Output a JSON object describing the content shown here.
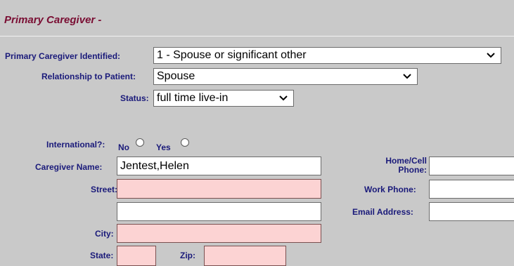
{
  "section": {
    "title": "Primary Caregiver -"
  },
  "form": {
    "caregiver_identified": {
      "label": "Primary Caregiver Identified:",
      "value": "1 - Spouse or significant other"
    },
    "relationship": {
      "label": "Relationship to Patient:",
      "value": "Spouse"
    },
    "status": {
      "label": "Status:",
      "value": "full time live-in"
    },
    "international": {
      "label": "International?:",
      "no_label": "No",
      "yes_label": "Yes"
    },
    "caregiver_name": {
      "label": "Caregiver Name:",
      "value": "Jentest,Helen"
    },
    "street": {
      "label": "Street:",
      "value": "",
      "value2": ""
    },
    "city": {
      "label": "City:",
      "value": ""
    },
    "state": {
      "label": "State:",
      "value": ""
    },
    "zip": {
      "label": "Zip:",
      "value": ""
    },
    "home_cell_phone": {
      "label_line1": "Home/Cell",
      "label_line2": "Phone:",
      "value": ""
    },
    "work_phone": {
      "label": "Work Phone:",
      "value": ""
    },
    "email": {
      "label": "Email Address:",
      "value": ""
    }
  },
  "icons": {
    "dropdown": "chevron-down-icon",
    "radio": "radio-icon"
  },
  "colors": {
    "background": "#c9c9c9",
    "title": "#7a0e33",
    "label": "#1a1a7a",
    "required_field": "#fcd3d3"
  }
}
